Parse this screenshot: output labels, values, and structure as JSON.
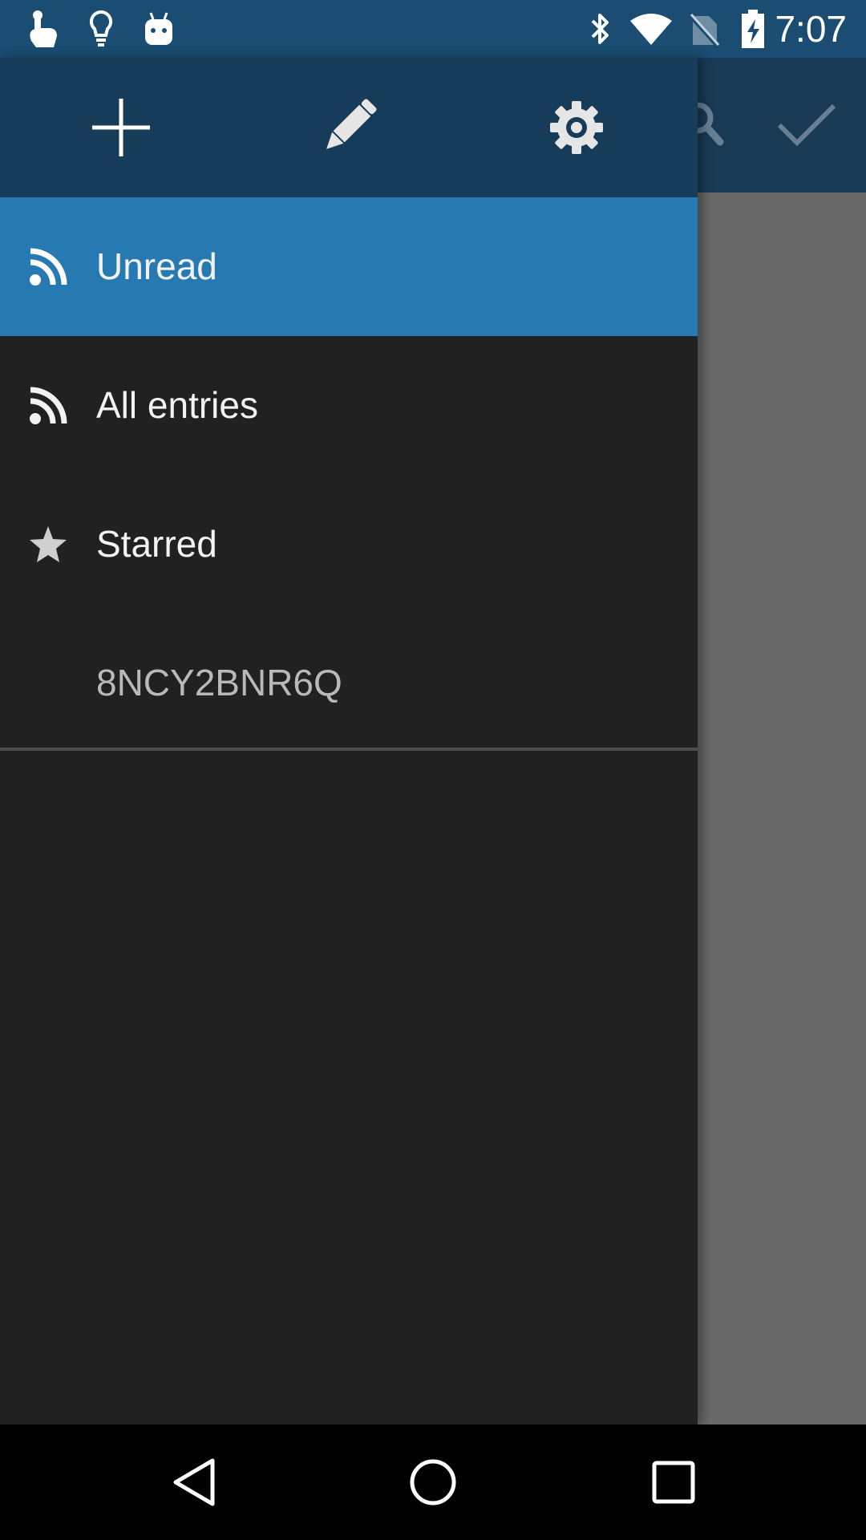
{
  "status_bar": {
    "time": "7:07",
    "icons_left": [
      "touch-icon",
      "lightbulb-icon",
      "android-icon"
    ],
    "icons_right": [
      "bluetooth-icon",
      "wifi-icon",
      "no-sim-icon",
      "battery-charging-icon"
    ]
  },
  "background_toolbar": {
    "icons": [
      "search-icon",
      "check-icon"
    ]
  },
  "drawer": {
    "header_buttons": [
      "add-icon",
      "pencil-icon",
      "settings-icon"
    ],
    "items": [
      {
        "label": "Unread",
        "icon": "rss-icon",
        "active": true
      },
      {
        "label": "All entries",
        "icon": "rss-icon",
        "active": false
      },
      {
        "label": "Starred",
        "icon": "star-icon",
        "active": false
      },
      {
        "label": "8NCY2BNR6Q",
        "icon": "",
        "active": false
      }
    ]
  },
  "nav_bar": {
    "buttons": [
      "back-icon",
      "home-icon",
      "recents-icon"
    ]
  },
  "colors": {
    "status_bar": "#1a4d71",
    "drawer_header": "#173c59",
    "active_item": "#267ab1",
    "drawer_bg": "#212121",
    "scrim": "#686868"
  }
}
